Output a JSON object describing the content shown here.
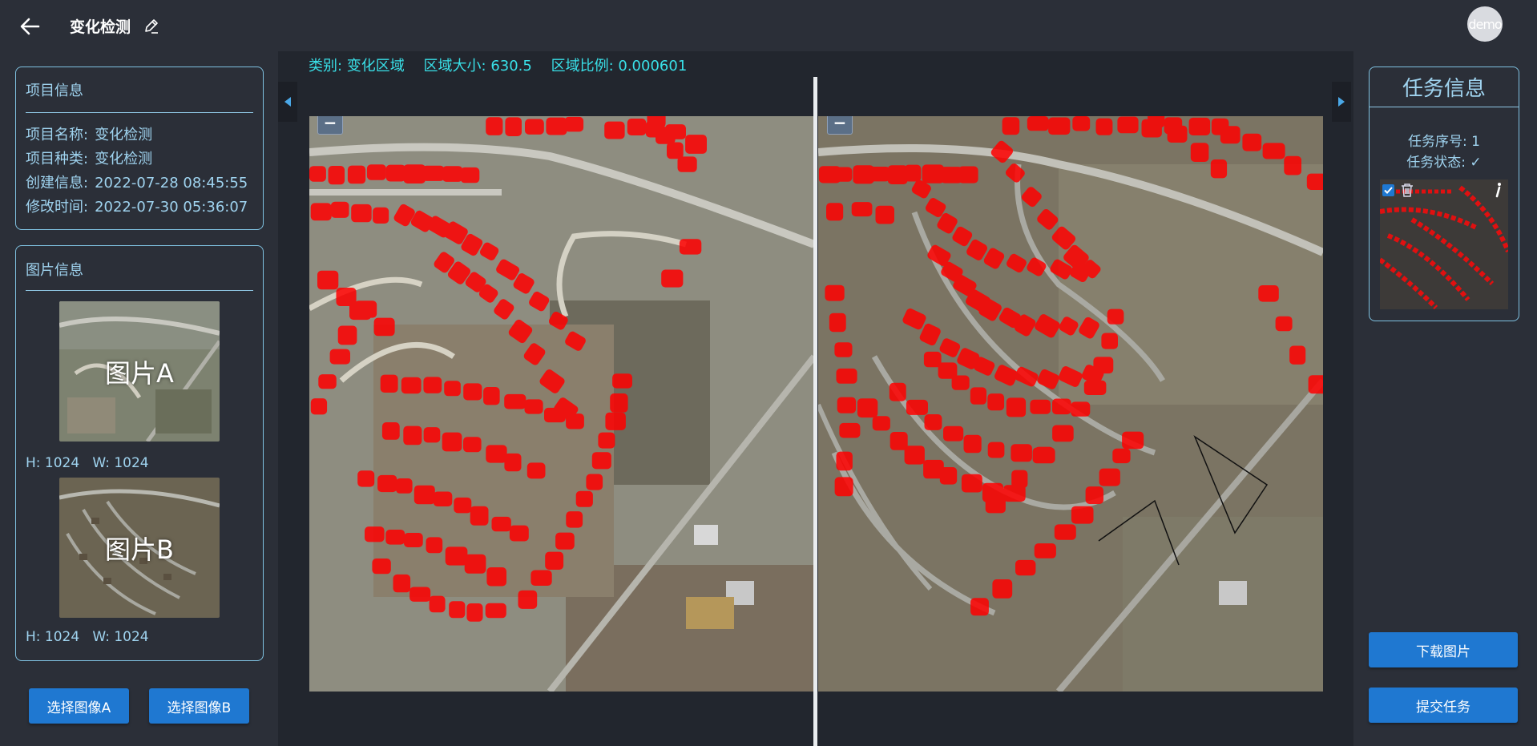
{
  "header": {
    "title": "变化检测",
    "avatar": "demo",
    "back_icon": "arrow-left-icon",
    "edit_icon": "pencil-icon"
  },
  "project_info": {
    "title": "项目信息",
    "rows": [
      {
        "label": "项目名称:",
        "value": "变化检测"
      },
      {
        "label": "项目种类:",
        "value": "变化检测"
      },
      {
        "label": "创建信息:",
        "value": "2022-07-28 08:45:55"
      },
      {
        "label": "修改时间:",
        "value": "2022-07-30 05:36:07"
      }
    ]
  },
  "image_info": {
    "title": "图片信息",
    "image_a": {
      "label": "图片A",
      "size": "H: 1024   W: 1024"
    },
    "image_b": {
      "label": "图片B",
      "size": "H: 1024   W: 1024"
    }
  },
  "buttons": {
    "select_a": "选择图像A",
    "select_b": "选择图像B",
    "download": "下载图片",
    "submit": "提交任务"
  },
  "status_bar": {
    "category": "类别: 变化区域",
    "area_size": "区域大小: 630.5",
    "area_ratio": "区域比例: 0.000601"
  },
  "zoom": {
    "in": "+",
    "out": "−"
  },
  "task_info": {
    "title": "任务信息",
    "task_number": "任务序号: 1",
    "task_status": "任务状态: ✓",
    "delete_icon": "trash-icon",
    "info_icon": "info-icon",
    "checked": true
  },
  "colors": {
    "accent": "#1f78d1",
    "text": "#9fd3ef",
    "status": "#39e0e8",
    "mask": "#ff0000",
    "background": "#2b2f38"
  }
}
